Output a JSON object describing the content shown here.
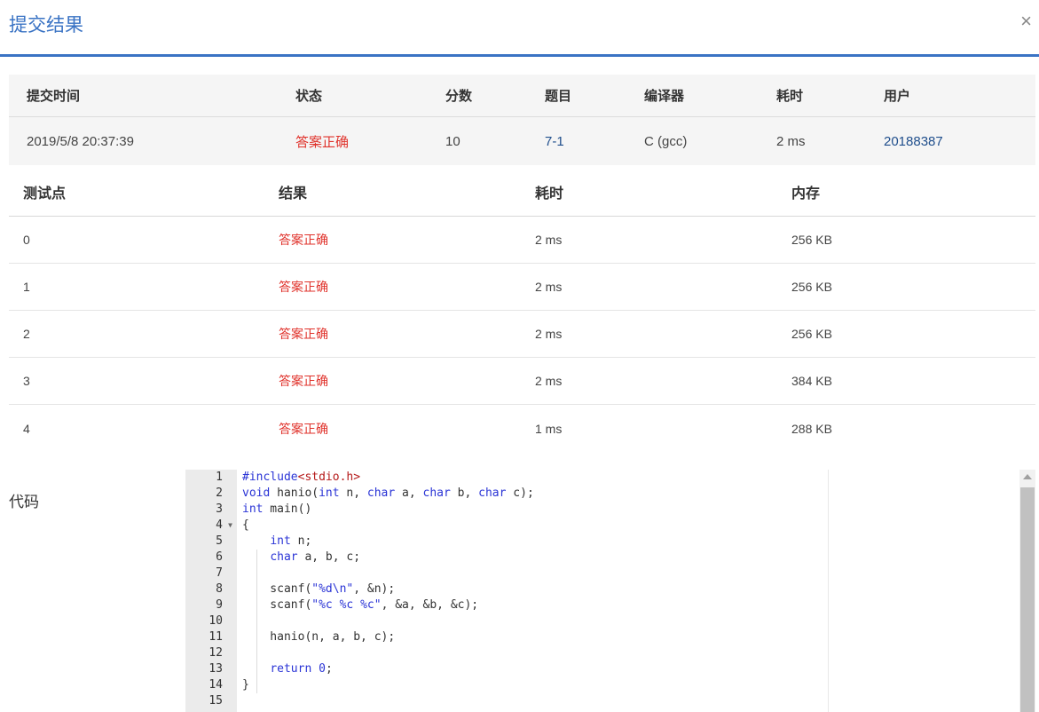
{
  "header": {
    "title": "提交结果",
    "close_glyph": "×"
  },
  "summary": {
    "headers": [
      "提交时间",
      "状态",
      "分数",
      "题目",
      "编译器",
      "耗时",
      "用户"
    ],
    "values": [
      "2019/5/8 20:37:39",
      "答案正确",
      "10",
      "7-1",
      "C (gcc)",
      "2 ms",
      "20188387"
    ]
  },
  "cases": {
    "headers": [
      "测试点",
      "结果",
      "耗时",
      "内存"
    ],
    "rows": [
      [
        "0",
        "答案正确",
        "2 ms",
        "256 KB"
      ],
      [
        "1",
        "答案正确",
        "2 ms",
        "256 KB"
      ],
      [
        "2",
        "答案正确",
        "2 ms",
        "256 KB"
      ],
      [
        "3",
        "答案正确",
        "2 ms",
        "384 KB"
      ],
      [
        "4",
        "答案正确",
        "1 ms",
        "288 KB"
      ]
    ]
  },
  "code": {
    "label": "代码",
    "line_numbers": [
      "1",
      "2",
      "3",
      "4",
      "5",
      "6",
      "7",
      "8",
      "9",
      "10",
      "11",
      "12",
      "13",
      "14",
      "15"
    ],
    "lines": [
      "#include<stdio.h>",
      "void hanio(int n, char a, char b, char c);",
      "int main()",
      "{",
      "    int n;",
      "    char a, b, c;",
      "",
      "    scanf(\"%d\\n\", &n);",
      "    scanf(\"%c %c %c\", &a, &b, &c);",
      "",
      "    hanio(n, a, b, c);",
      "",
      "    return 0;",
      "}",
      ""
    ]
  },
  "colors": {
    "accent": "#3a73c4",
    "status_ok": "#e0322b",
    "link": "#1f4e8c"
  }
}
